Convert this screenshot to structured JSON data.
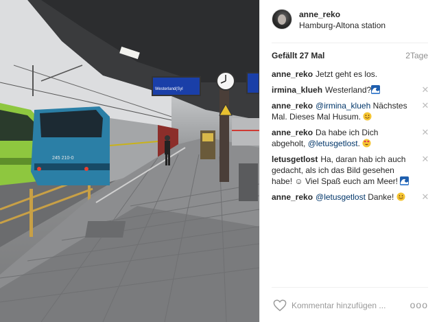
{
  "post": {
    "username": "anne_reko",
    "location": "Hamburg-Altona station",
    "likes_label": "Gefällt 27 Mal",
    "time_ago": "2Tage"
  },
  "comments": [
    {
      "user": "anne_reko",
      "parts": [
        {
          "text": "Jetzt geht es los."
        }
      ],
      "deletable": false
    },
    {
      "user": "irmina_klueh",
      "parts": [
        {
          "text": "Westerland?"
        },
        {
          "emoji": "wave-emoji"
        }
      ],
      "deletable": true
    },
    {
      "user": "anne_reko",
      "parts": [
        {
          "mention": "@irmina_klueh"
        },
        {
          "text": " Nächstes Mal. Dieses Mal Husum. "
        },
        {
          "emoji": "smile-emoji"
        }
      ],
      "deletable": true
    },
    {
      "user": "anne_reko",
      "parts": [
        {
          "text": "Da habe ich Dich abgeholt, "
        },
        {
          "mention": "@letusgetlost"
        },
        {
          "text": ". "
        },
        {
          "emoji": "heart-eyes-emoji"
        }
      ],
      "deletable": true
    },
    {
      "user": "letusgetlost",
      "parts": [
        {
          "text": "Ha, daran hab ich auch gedacht, als ich das Bild gesehen habe! ☺ Viel Spaß euch am Meer! "
        },
        {
          "emoji": "wave-emoji"
        }
      ],
      "deletable": true
    },
    {
      "user": "anne_reko",
      "parts": [
        {
          "mention": "@letusgetlost"
        },
        {
          "text": " Danke! "
        },
        {
          "emoji": "smile-emoji"
        }
      ],
      "deletable": true
    }
  ],
  "footer": {
    "comment_placeholder": "Kommentar hinzufügen ...",
    "more_label": "ooo"
  },
  "photo": {
    "locomotive_number": "245 210-0",
    "display_text": "Westerland(Syl"
  },
  "colors": {
    "mention": "#003569",
    "locomotive": "#2b7fa6",
    "green_train": "#8ec73f",
    "display": "#1a3fa8"
  }
}
